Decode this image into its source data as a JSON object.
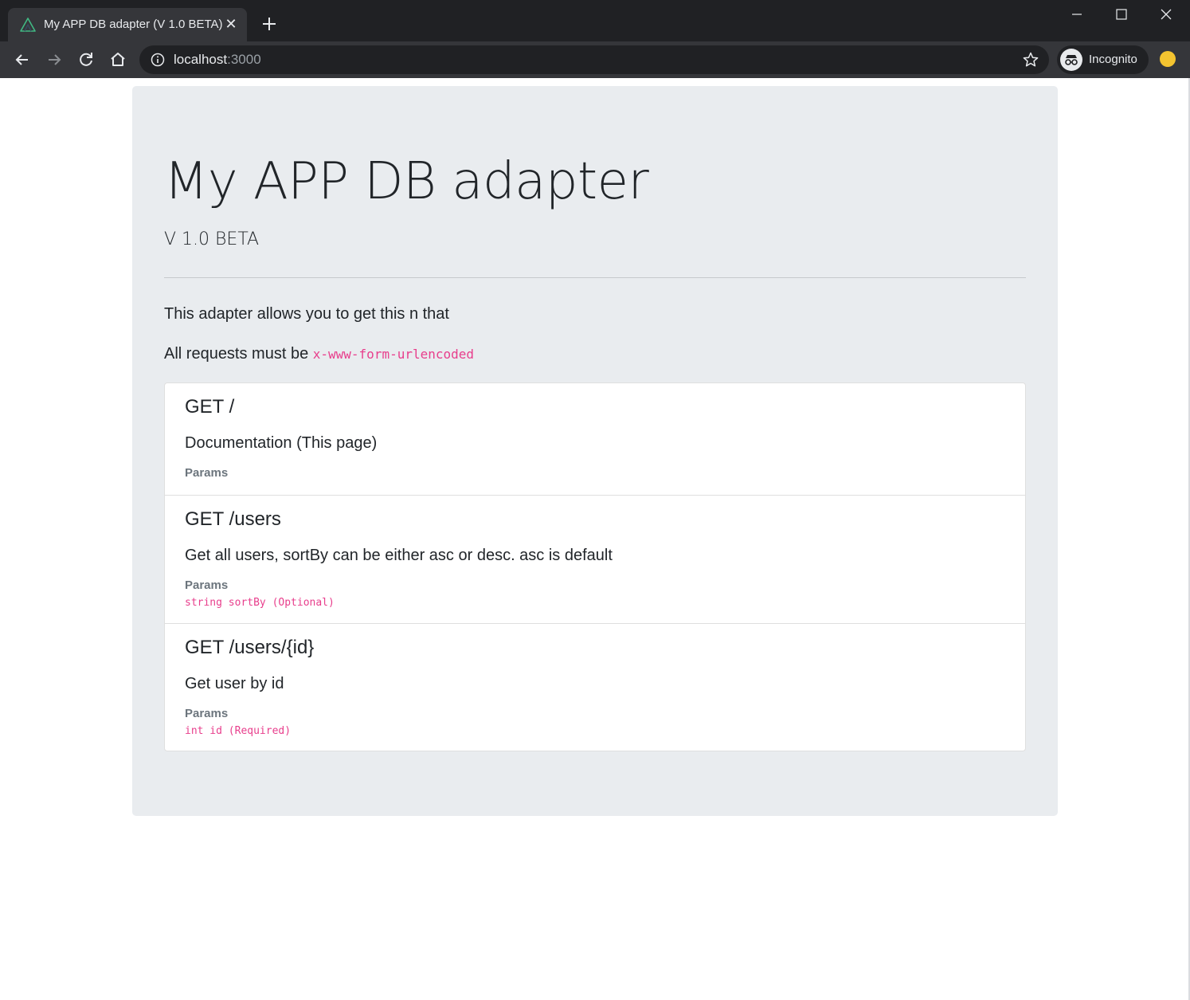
{
  "browser": {
    "tab_title": "My APP DB adapter (V 1.0 BETA)",
    "tab_close": "✕",
    "url_host": "localhost",
    "url_port": ":3000",
    "profile_label": "Incognito",
    "icons": {
      "favicon": "vue-logo-icon",
      "new_tab": "plus-icon",
      "minimize": "minimize-icon",
      "maximize": "maximize-icon",
      "close": "close-icon",
      "back": "back-arrow-icon",
      "forward": "forward-arrow-icon",
      "reload": "reload-icon",
      "home": "home-icon",
      "site_info": "info-icon",
      "bookmark": "star-icon",
      "incognito": "incognito-icon",
      "extension": "extension-icon"
    }
  },
  "page": {
    "title": "My APP DB adapter",
    "subtitle": "V 1.0 BETA",
    "intro_text": "This adapter allows you to get this n that",
    "requests_prefix": "All requests must be ",
    "requests_encoding": "x-www-form-urlencoded"
  },
  "endpoints": [
    {
      "method_path": "GET /",
      "description": "Documentation (This page)",
      "params_label": "Params",
      "param": ""
    },
    {
      "method_path": "GET /users",
      "description": "Get all users, sortBy can be either asc or desc. asc is default",
      "params_label": "Params",
      "param": "string sortBy (Optional)"
    },
    {
      "method_path": "GET /users/{id}",
      "description": "Get user by id",
      "params_label": "Params",
      "param": "int id (Required)"
    }
  ],
  "colors": {
    "chrome_dark": "#202124",
    "chrome_toolbar": "#35363a",
    "jumbotron_bg": "#e9ecef",
    "code_pink": "#e83e8c",
    "muted_text": "#6c757d",
    "vue_green": "#41b883"
  }
}
